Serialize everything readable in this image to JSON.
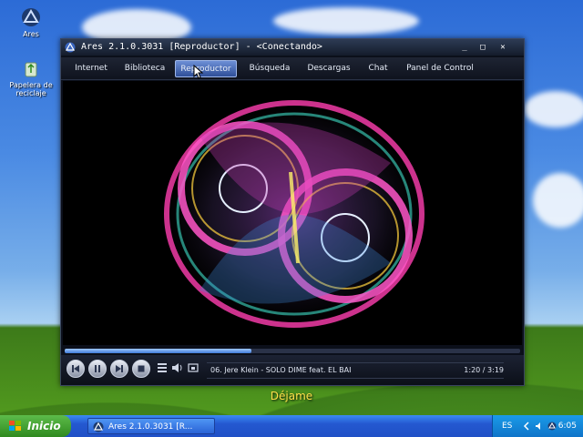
{
  "desktop": {
    "icons": [
      {
        "label": "Ares",
        "icon": "ares-logo-icon"
      },
      {
        "label": "Papelera de reciclaje",
        "icon": "recycle-bin-icon"
      }
    ]
  },
  "window": {
    "title": "Ares 2.1.0.3031  [Reproductor]  - <Conectando>",
    "controls": {
      "minimize": "_",
      "maximize": "□",
      "close": "✕"
    }
  },
  "tabs": [
    {
      "label": "Internet",
      "active": false
    },
    {
      "label": "Biblioteca",
      "active": false
    },
    {
      "label": "Reproductor",
      "active": true
    },
    {
      "label": "Búsqueda",
      "active": false
    },
    {
      "label": "Descargas",
      "active": false
    },
    {
      "label": "Chat",
      "active": false
    },
    {
      "label": "Panel de Control",
      "active": false
    }
  ],
  "player": {
    "progress_fraction": 0.41,
    "now_playing": "06. Jere Klein - SOLO DIME  feat. EL BAI",
    "time": "1:20 / 3:19"
  },
  "subtitle": "Déjame",
  "taskbar": {
    "start_label": "Inicio",
    "task_label": "Ares 2.1.0.3031 [R...",
    "language": "ES",
    "clock": "6:05"
  },
  "colors": {
    "accent": "#2f4f98",
    "subtitle": "#ffe14a",
    "start": "#3c9a2b"
  }
}
